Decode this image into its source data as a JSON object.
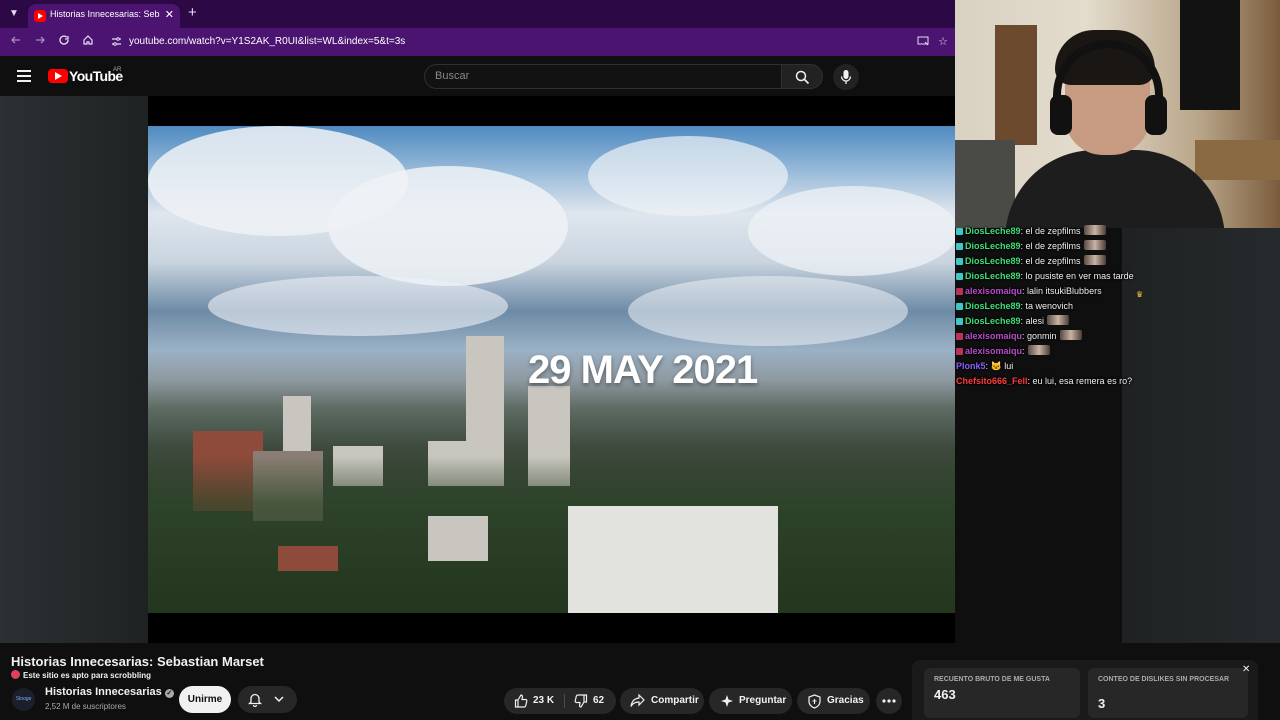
{
  "browser": {
    "tab_title": "Historias Innecesarias: Sebastia",
    "tab_close": "✕",
    "new_tab": "+",
    "url": "youtube.com/watch?v=Y1S2AK_R0UI&list=WL&index=5&t=3s"
  },
  "youtube_header": {
    "logo_text": "YouTube",
    "country": "AR",
    "search_placeholder": "Buscar"
  },
  "video": {
    "caption": "29 MAY 2021"
  },
  "chat": {
    "messages": [
      {
        "user": "DiosLeche89",
        "text": ": el de zepfilms",
        "color": "#3ee07a",
        "badge": "#41c7c7",
        "emote": true
      },
      {
        "user": "DiosLeche89",
        "text": ": el de zepfilms",
        "color": "#3ee07a",
        "badge": "#41c7c7",
        "emote": true
      },
      {
        "user": "DiosLeche89",
        "text": ": el de zepfilms",
        "color": "#3ee07a",
        "badge": "#41c7c7",
        "emote": true
      },
      {
        "user": "DiosLeche89",
        "text": ": lo pusiste en ver mas tarde",
        "color": "#3ee07a",
        "badge": "#41c7c7",
        "emote": false
      },
      {
        "user": "alexisomaiqu",
        "text": ": lalin itsukiBlubbers",
        "color": "#b64dc8",
        "badge": "#b8325a",
        "emote": false
      },
      {
        "user": "DiosLeche89",
        "text": ": ta wenovich",
        "color": "#3ee07a",
        "badge": "#41c7c7",
        "emote": false
      },
      {
        "user": "DiosLeche89",
        "text": ": alesi",
        "color": "#3ee07a",
        "badge": "#41c7c7",
        "emote": true
      },
      {
        "user": "alexisomaiqu",
        "text": ": gonmin",
        "color": "#b64dc8",
        "badge": "#b8325a",
        "emote": true
      },
      {
        "user": "alexisomaiqu",
        "text": ":",
        "color": "#b64dc8",
        "badge": "#b8325a",
        "emote": true
      },
      {
        "user": "Plonk5",
        "text": ": 🐱 lui",
        "color": "#8a5cff",
        "badge": "",
        "emote": false
      },
      {
        "user": "Chefsito666_Fell",
        "text": ": eu lui, esa remera es ro?",
        "color": "#ff3b3b",
        "badge": "",
        "emote": false
      }
    ]
  },
  "below": {
    "title": "Historias Innecesarias: Sebastian Marset",
    "scrobble_text": "Este sitio es apto para scrobbling",
    "channel_name": "Historias Innecesarias",
    "channel_avatar_text": "Stooge",
    "subscribers": "2,52 M de suscriptores",
    "join_label": "Unirme",
    "like_count": "23 K",
    "dislike_count": "62",
    "share_label": "Compartir",
    "ask_label": "Preguntar",
    "thanks_label": "Gracias"
  },
  "stats_panel": {
    "likes_label": "RECUENTO BRUTO DE ME GUSTA",
    "likes_value": "463",
    "dislikes_label": "CONTEO DE DISLIKES SIN PROCESAR",
    "dislikes_value": "3",
    "close": "✕"
  },
  "colors": {
    "browser_purple": "#4a1470",
    "youtube_red": "#ff0000"
  }
}
